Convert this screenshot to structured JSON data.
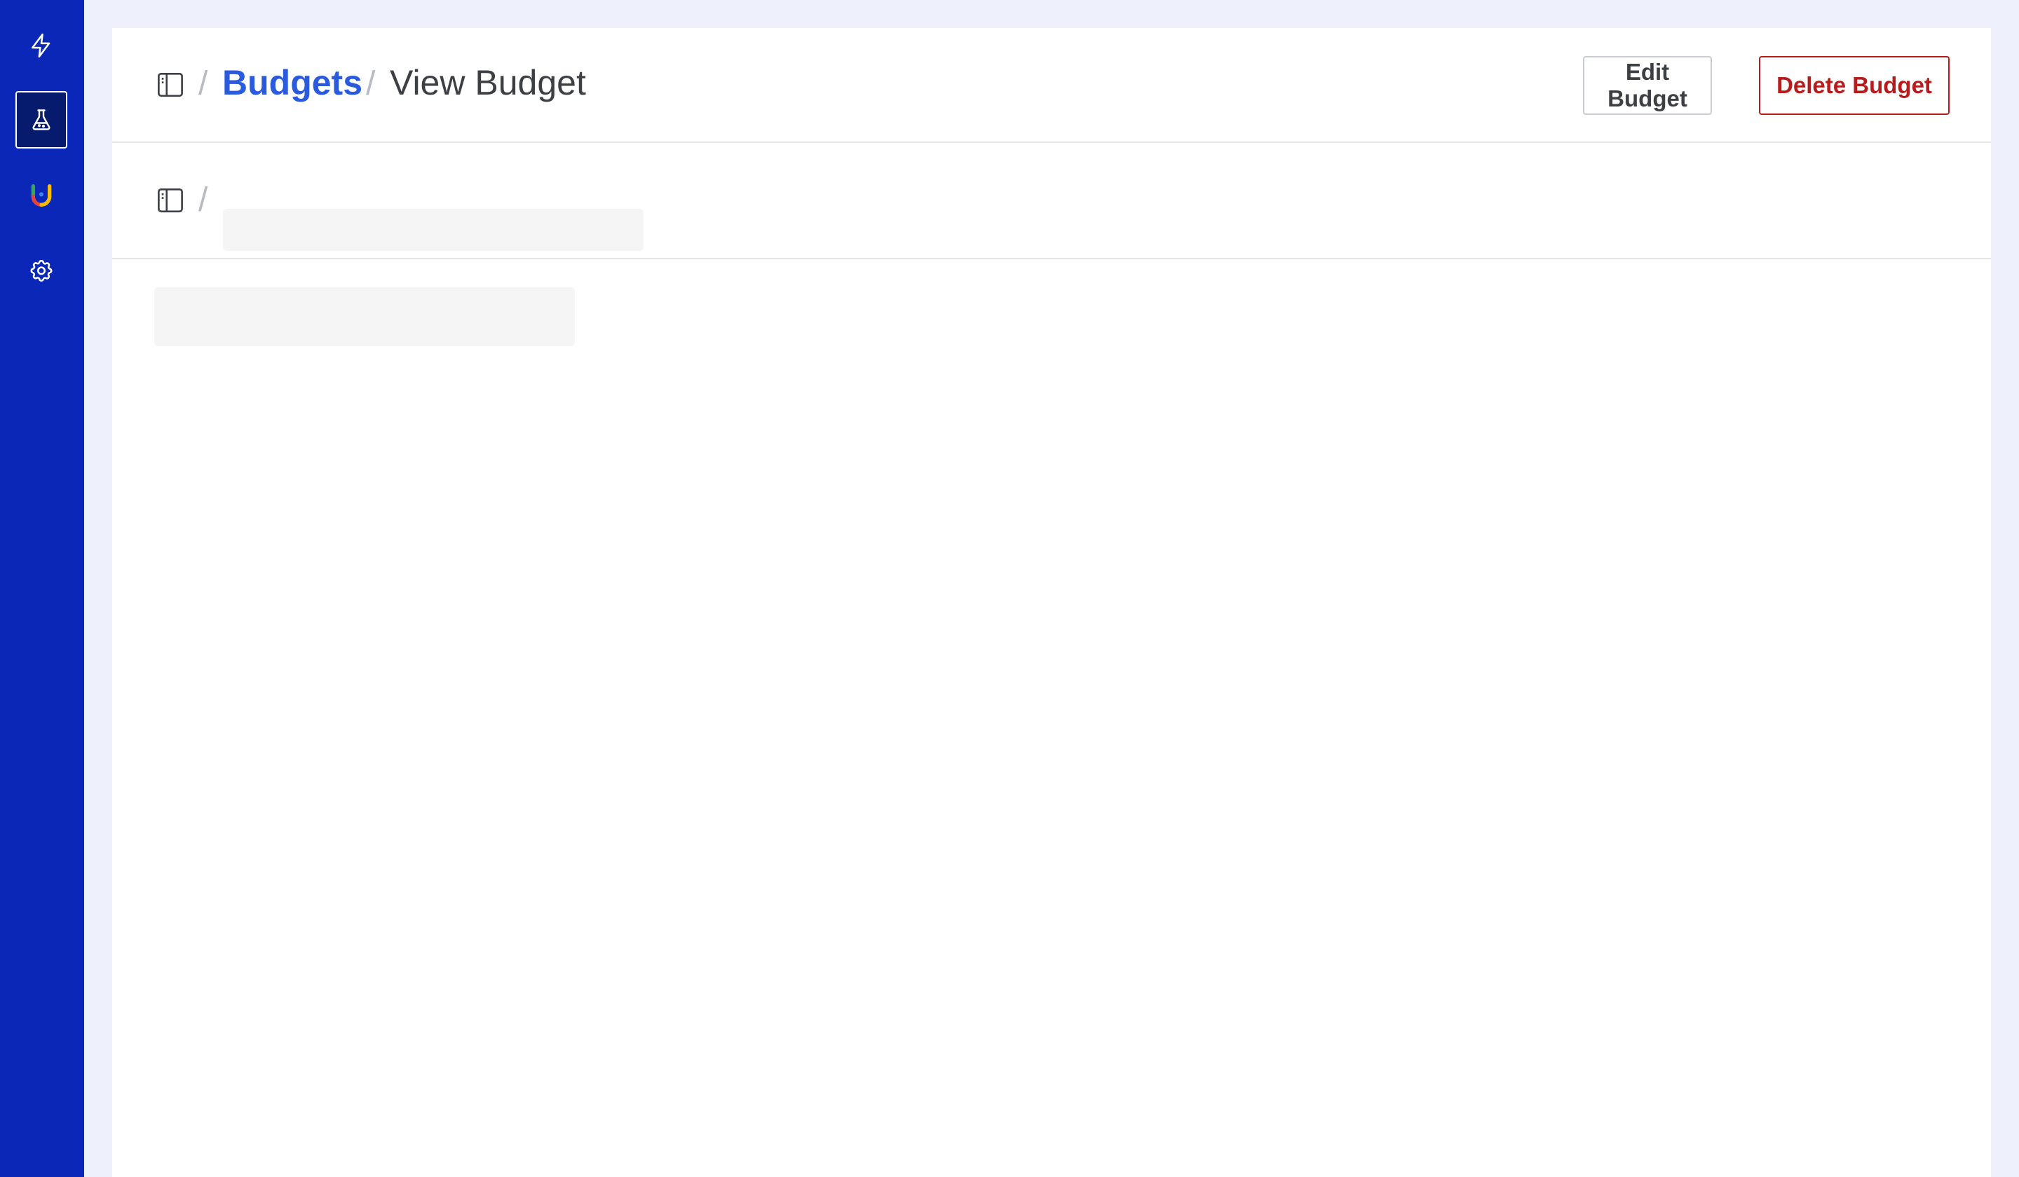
{
  "sidebar": {
    "items": [
      {
        "icon": "lightning-icon",
        "active": false
      },
      {
        "icon": "flask-icon",
        "active": true
      },
      {
        "icon": "brand-logo-icon",
        "active": false
      },
      {
        "icon": "gear-icon",
        "active": false
      }
    ]
  },
  "header": {
    "breadcrumb": {
      "link_label": "Budgets",
      "separator": "/",
      "current_label": "View Budget"
    },
    "edit_button_label": "Edit Budget",
    "delete_button_label": "Delete Budget"
  },
  "sub_header": {
    "separator": "/"
  },
  "colors": {
    "sidebar": "#0a27b7",
    "page_background": "#eef1fb",
    "link": "#2a5bde",
    "danger": "#b71c1c",
    "skeleton": "#f5f5f6"
  }
}
